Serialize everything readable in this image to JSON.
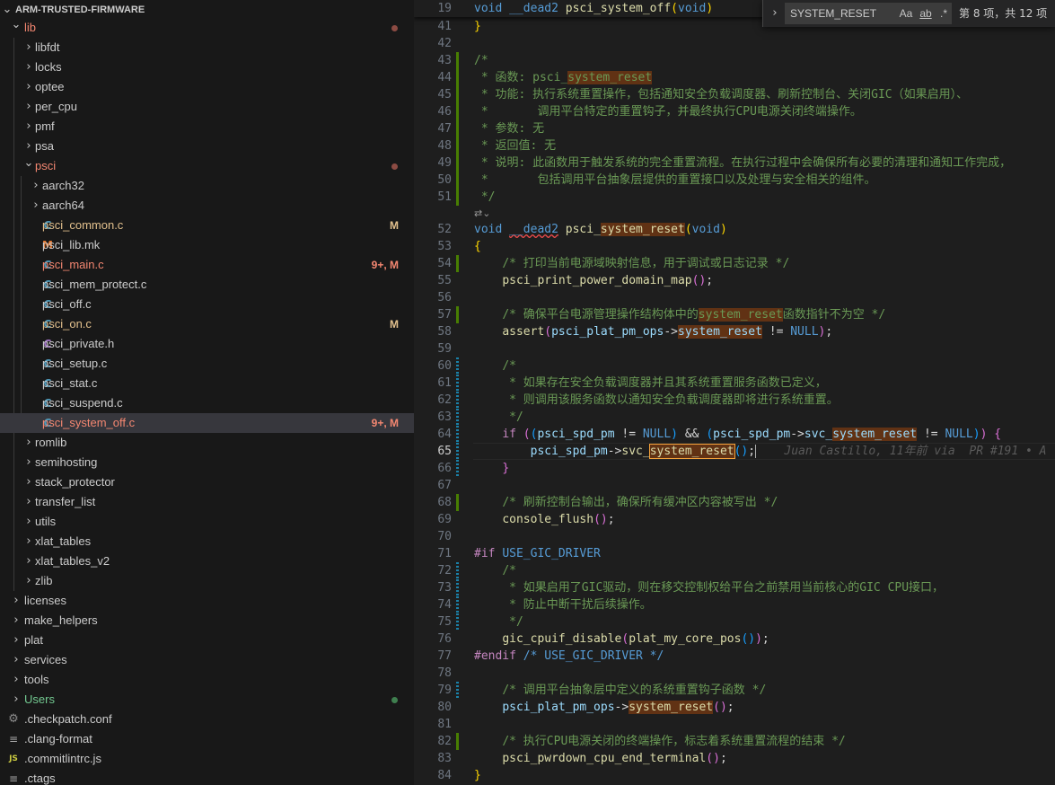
{
  "explorer": {
    "root_label": "ARM-TRUSTED-FIRMWARE",
    "items": [
      {
        "label": "lib",
        "kind": "folder-open",
        "depth": 0,
        "color": "#f48771",
        "status": "dot",
        "status_color": "#8c4b43"
      },
      {
        "label": "libfdt",
        "kind": "folder",
        "depth": 1,
        "color": "#cccccc"
      },
      {
        "label": "locks",
        "kind": "folder",
        "depth": 1,
        "color": "#cccccc"
      },
      {
        "label": "optee",
        "kind": "folder",
        "depth": 1,
        "color": "#cccccc"
      },
      {
        "label": "per_cpu",
        "kind": "folder",
        "depth": 1,
        "color": "#cccccc"
      },
      {
        "label": "pmf",
        "kind": "folder",
        "depth": 1,
        "color": "#cccccc"
      },
      {
        "label": "psa",
        "kind": "folder",
        "depth": 1,
        "color": "#cccccc"
      },
      {
        "label": "psci",
        "kind": "folder-open",
        "depth": 1,
        "color": "#f48771",
        "status": "dot",
        "status_color": "#8c4b43"
      },
      {
        "label": "aarch32",
        "kind": "folder",
        "depth": 2,
        "color": "#cccccc"
      },
      {
        "label": "aarch64",
        "kind": "folder",
        "depth": 2,
        "color": "#cccccc"
      },
      {
        "label": "psci_common.c",
        "kind": "c",
        "depth": 2,
        "color": "#e2c08d",
        "status": "M",
        "status_color": "#e2c08d"
      },
      {
        "label": "psci_lib.mk",
        "kind": "mk",
        "depth": 2,
        "color": "#cccccc"
      },
      {
        "label": "psci_main.c",
        "kind": "c",
        "depth": 2,
        "color": "#f48771",
        "status": "9+, M",
        "status_color": "#f48771"
      },
      {
        "label": "psci_mem_protect.c",
        "kind": "c",
        "depth": 2,
        "color": "#cccccc"
      },
      {
        "label": "psci_off.c",
        "kind": "c",
        "depth": 2,
        "color": "#cccccc"
      },
      {
        "label": "psci_on.c",
        "kind": "c",
        "depth": 2,
        "color": "#e2c08d",
        "status": "M",
        "status_color": "#e2c08d"
      },
      {
        "label": "psci_private.h",
        "kind": "h",
        "depth": 2,
        "color": "#cccccc"
      },
      {
        "label": "psci_setup.c",
        "kind": "c",
        "depth": 2,
        "color": "#cccccc"
      },
      {
        "label": "psci_stat.c",
        "kind": "c",
        "depth": 2,
        "color": "#cccccc"
      },
      {
        "label": "psci_suspend.c",
        "kind": "c",
        "depth": 2,
        "color": "#cccccc"
      },
      {
        "label": "psci_system_off.c",
        "kind": "c",
        "depth": 2,
        "color": "#f48771",
        "status": "9+, M",
        "status_color": "#f48771",
        "selected": true
      },
      {
        "label": "romlib",
        "kind": "folder",
        "depth": 1,
        "color": "#cccccc"
      },
      {
        "label": "semihosting",
        "kind": "folder",
        "depth": 1,
        "color": "#cccccc"
      },
      {
        "label": "stack_protector",
        "kind": "folder",
        "depth": 1,
        "color": "#cccccc"
      },
      {
        "label": "transfer_list",
        "kind": "folder",
        "depth": 1,
        "color": "#cccccc"
      },
      {
        "label": "utils",
        "kind": "folder",
        "depth": 1,
        "color": "#cccccc"
      },
      {
        "label": "xlat_tables",
        "kind": "folder",
        "depth": 1,
        "color": "#cccccc"
      },
      {
        "label": "xlat_tables_v2",
        "kind": "folder",
        "depth": 1,
        "color": "#cccccc"
      },
      {
        "label": "zlib",
        "kind": "folder",
        "depth": 1,
        "color": "#cccccc"
      },
      {
        "label": "licenses",
        "kind": "folder",
        "depth": 0,
        "color": "#cccccc"
      },
      {
        "label": "make_helpers",
        "kind": "folder",
        "depth": 0,
        "color": "#cccccc"
      },
      {
        "label": "plat",
        "kind": "folder",
        "depth": 0,
        "color": "#cccccc"
      },
      {
        "label": "services",
        "kind": "folder",
        "depth": 0,
        "color": "#cccccc"
      },
      {
        "label": "tools",
        "kind": "folder",
        "depth": 0,
        "color": "#cccccc"
      },
      {
        "label": "Users",
        "kind": "folder",
        "depth": 0,
        "color": "#73c991",
        "status": "dot",
        "status_color": "#3f7f4f"
      },
      {
        "label": ".checkpatch.conf",
        "kind": "gear",
        "depth": -1,
        "color": "#cccccc"
      },
      {
        "label": ".clang-format",
        "kind": "lines",
        "depth": -1,
        "color": "#cccccc"
      },
      {
        "label": ".commitlintrc.js",
        "kind": "js",
        "depth": -1,
        "color": "#cccccc"
      },
      {
        "label": ".ctags",
        "kind": "lines",
        "depth": -1,
        "color": "#cccccc"
      }
    ]
  },
  "find": {
    "query": "SYSTEM_RESET",
    "match_case": "Aa",
    "whole_word": "ab",
    "regex": ".*",
    "count": "第 8 项，共 12 项"
  },
  "editor": {
    "sticky_line": {
      "number": "19",
      "tokens": [
        {
          "t": "void",
          "c": "kw"
        },
        {
          "t": " "
        },
        {
          "t": "__dead2",
          "c": "kw"
        },
        {
          "t": " "
        },
        {
          "t": "psci_system_off",
          "c": "fn"
        },
        {
          "t": "(",
          "c": "br1"
        },
        {
          "t": "void",
          "c": "kw"
        },
        {
          "t": ")",
          "c": "br1"
        }
      ]
    },
    "codelens_icon": "git-compare-icon",
    "lines": [
      {
        "n": "41",
        "tokens": [
          {
            "t": "}",
            "c": "br1"
          }
        ]
      },
      {
        "n": "42",
        "tokens": []
      },
      {
        "n": "43",
        "gutter": "green",
        "tokens": [
          {
            "t": "/*",
            "c": "cm"
          }
        ]
      },
      {
        "n": "44",
        "gutter": "green",
        "tokens": [
          {
            "t": " * 函数: psci_",
            "c": "cm"
          },
          {
            "t": "system_reset",
            "c": "cm hl"
          }
        ]
      },
      {
        "n": "45",
        "gutter": "green",
        "tokens": [
          {
            "t": " * 功能: 执行系统重置操作，包括通知安全负载调度器、刷新控制台、关闭GIC（如果启用）、",
            "c": "cm"
          }
        ]
      },
      {
        "n": "46",
        "gutter": "green",
        "tokens": [
          {
            "t": " *       调用平台特定的重置钩子，并最终执行CPU电源关闭终端操作。",
            "c": "cm"
          }
        ]
      },
      {
        "n": "47",
        "gutter": "green",
        "tokens": [
          {
            "t": " * 参数: 无",
            "c": "cm"
          }
        ]
      },
      {
        "n": "48",
        "gutter": "green",
        "tokens": [
          {
            "t": " * 返回值: 无",
            "c": "cm"
          }
        ]
      },
      {
        "n": "49",
        "gutter": "green",
        "tokens": [
          {
            "t": " * 说明: 此函数用于触发系统的完全重置流程。在执行过程中会确保所有必要的清理和通知工作完成，",
            "c": "cm"
          }
        ]
      },
      {
        "n": "50",
        "gutter": "green",
        "tokens": [
          {
            "t": " *       包括调用平台抽象层提供的重置接口以及处理与安全相关的组件。",
            "c": "cm"
          }
        ]
      },
      {
        "n": "51",
        "gutter": "green",
        "tokens": [
          {
            "t": " */",
            "c": "cm"
          }
        ]
      },
      {
        "n": "",
        "codelens": true,
        "tokens": []
      },
      {
        "n": "52",
        "tokens": [
          {
            "t": "void",
            "c": "kw"
          },
          {
            "t": " "
          },
          {
            "t": "__dead2",
            "c": "kw sq"
          },
          {
            "t": " "
          },
          {
            "t": "psci_",
            "c": "fn"
          },
          {
            "t": "system_reset",
            "c": "fn hl"
          },
          {
            "t": "(",
            "c": "br1"
          },
          {
            "t": "void",
            "c": "kw"
          },
          {
            "t": ")",
            "c": "br1"
          }
        ]
      },
      {
        "n": "53",
        "tokens": [
          {
            "t": "{",
            "c": "br1"
          }
        ]
      },
      {
        "n": "54",
        "gutter": "green",
        "tokens": [
          {
            "t": "    "
          },
          {
            "t": "/* 打印当前电源域映射信息，用于调试或日志记录 */",
            "c": "cm"
          }
        ]
      },
      {
        "n": "55",
        "tokens": [
          {
            "t": "    "
          },
          {
            "t": "psci_print_power_domain_map",
            "c": "fn"
          },
          {
            "t": "()",
            "c": "br2"
          },
          {
            "t": ";"
          }
        ]
      },
      {
        "n": "56",
        "tokens": []
      },
      {
        "n": "57",
        "gutter": "green",
        "tokens": [
          {
            "t": "    "
          },
          {
            "t": "/* 确保平台电源管理操作结构体中的",
            "c": "cm"
          },
          {
            "t": "system_reset",
            "c": "cm hl"
          },
          {
            "t": "函数指针不为空 */",
            "c": "cm"
          }
        ]
      },
      {
        "n": "58",
        "tokens": [
          {
            "t": "    "
          },
          {
            "t": "assert",
            "c": "fn"
          },
          {
            "t": "(",
            "c": "br2"
          },
          {
            "t": "psci_plat_pm_ops",
            "c": "var"
          },
          {
            "t": "->"
          },
          {
            "t": "system_reset",
            "c": "var hl"
          },
          {
            "t": " != "
          },
          {
            "t": "NULL",
            "c": "kw"
          },
          {
            "t": ")",
            "c": "br2"
          },
          {
            "t": ";"
          }
        ]
      },
      {
        "n": "59",
        "tokens": []
      },
      {
        "n": "60",
        "gutter": "blue",
        "tokens": [
          {
            "t": "    "
          },
          {
            "t": "/*",
            "c": "cm"
          }
        ]
      },
      {
        "n": "61",
        "gutter": "blue",
        "tokens": [
          {
            "t": "    "
          },
          {
            "t": " * 如果存在安全负载调度器并且其系统重置服务函数已定义，",
            "c": "cm"
          }
        ]
      },
      {
        "n": "62",
        "gutter": "blue",
        "tokens": [
          {
            "t": "    "
          },
          {
            "t": " * 则调用该服务函数以通知安全负载调度器即将进行系统重置。",
            "c": "cm"
          }
        ]
      },
      {
        "n": "63",
        "gutter": "blue",
        "tokens": [
          {
            "t": "    "
          },
          {
            "t": " */",
            "c": "cm"
          }
        ]
      },
      {
        "n": "64",
        "gutter": "blue",
        "tokens": [
          {
            "t": "    "
          },
          {
            "t": "if",
            "c": "pp"
          },
          {
            "t": " "
          },
          {
            "t": "(",
            "c": "br2"
          },
          {
            "t": "(",
            "c": "br3"
          },
          {
            "t": "psci_spd_pm",
            "c": "var"
          },
          {
            "t": " != "
          },
          {
            "t": "NULL",
            "c": "kw"
          },
          {
            "t": ")",
            "c": "br3"
          },
          {
            "t": " && "
          },
          {
            "t": "(",
            "c": "br3"
          },
          {
            "t": "psci_spd_pm",
            "c": "var"
          },
          {
            "t": "->"
          },
          {
            "t": "svc_",
            "c": "var"
          },
          {
            "t": "system_reset",
            "c": "var hl"
          },
          {
            "t": " != "
          },
          {
            "t": "NULL",
            "c": "kw"
          },
          {
            "t": ")",
            "c": "br3"
          },
          {
            "t": ")",
            "c": "br2"
          },
          {
            "t": " "
          },
          {
            "t": "{",
            "c": "br2"
          }
        ]
      },
      {
        "n": "65",
        "current": true,
        "gutter": "blue",
        "tokens": [
          {
            "t": "        "
          },
          {
            "t": "psci_spd_pm",
            "c": "var"
          },
          {
            "t": "->"
          },
          {
            "t": "svc_",
            "c": "fn"
          },
          {
            "t": "system_reset",
            "c": "fn hlc"
          },
          {
            "t": "()",
            "c": "br3"
          },
          {
            "t": ";"
          }
        ],
        "blame": "Juan Castillo, 11年前 via  PR #191 • A"
      },
      {
        "n": "66",
        "gutter": "blue",
        "tokens": [
          {
            "t": "    "
          },
          {
            "t": "}",
            "c": "br2"
          }
        ]
      },
      {
        "n": "67",
        "tokens": []
      },
      {
        "n": "68",
        "gutter": "green",
        "tokens": [
          {
            "t": "    "
          },
          {
            "t": "/* 刷新控制台输出，确保所有缓冲区内容被写出 */",
            "c": "cm"
          }
        ]
      },
      {
        "n": "69",
        "tokens": [
          {
            "t": "    "
          },
          {
            "t": "console_flush",
            "c": "fn"
          },
          {
            "t": "()",
            "c": "br2"
          },
          {
            "t": ";"
          }
        ]
      },
      {
        "n": "70",
        "tokens": []
      },
      {
        "n": "71",
        "tokens": [
          {
            "t": "#if",
            "c": "pp"
          },
          {
            "t": " "
          },
          {
            "t": "USE_GIC_DRIVER",
            "c": "kw"
          }
        ]
      },
      {
        "n": "72",
        "gutter": "blue",
        "tokens": [
          {
            "t": "    "
          },
          {
            "t": "/*",
            "c": "cm"
          }
        ]
      },
      {
        "n": "73",
        "gutter": "blue",
        "tokens": [
          {
            "t": "    "
          },
          {
            "t": " * 如果启用了GIC驱动，则在移交控制权给平台之前禁用当前核心的GIC CPU接口，",
            "c": "cm"
          }
        ]
      },
      {
        "n": "74",
        "gutter": "blue",
        "tokens": [
          {
            "t": "    "
          },
          {
            "t": " * 防止中断干扰后续操作。",
            "c": "cm"
          }
        ]
      },
      {
        "n": "75",
        "gutter": "blue",
        "tokens": [
          {
            "t": "    "
          },
          {
            "t": " */",
            "c": "cm"
          }
        ]
      },
      {
        "n": "76",
        "tokens": [
          {
            "t": "    "
          },
          {
            "t": "gic_cpuif_disable",
            "c": "fn"
          },
          {
            "t": "(",
            "c": "br2"
          },
          {
            "t": "plat_my_core_pos",
            "c": "fn"
          },
          {
            "t": "()",
            "c": "br3"
          },
          {
            "t": ")",
            "c": "br2"
          },
          {
            "t": ";"
          }
        ]
      },
      {
        "n": "77",
        "tokens": [
          {
            "t": "#endif",
            "c": "pp"
          },
          {
            "t": " "
          },
          {
            "t": "/* USE_GIC_DRIVER */",
            "c": "kw"
          }
        ]
      },
      {
        "n": "78",
        "tokens": []
      },
      {
        "n": "79",
        "gutter": "blue",
        "tokens": [
          {
            "t": "    "
          },
          {
            "t": "/* 调用平台抽象层中定义的系统重置钩子函数 */",
            "c": "cm"
          }
        ]
      },
      {
        "n": "80",
        "tokens": [
          {
            "t": "    "
          },
          {
            "t": "psci_plat_pm_ops",
            "c": "var"
          },
          {
            "t": "->"
          },
          {
            "t": "system_reset",
            "c": "fn hl"
          },
          {
            "t": "()",
            "c": "br2"
          },
          {
            "t": ";"
          }
        ]
      },
      {
        "n": "81",
        "tokens": []
      },
      {
        "n": "82",
        "gutter": "green",
        "tokens": [
          {
            "t": "    "
          },
          {
            "t": "/* 执行CPU电源关闭的终端操作，标志着系统重置流程的结束 */",
            "c": "cm"
          }
        ]
      },
      {
        "n": "83",
        "tokens": [
          {
            "t": "    "
          },
          {
            "t": "psci_pwrdown_cpu_end_terminal",
            "c": "fn"
          },
          {
            "t": "()",
            "c": "br2"
          },
          {
            "t": ";"
          }
        ]
      },
      {
        "n": "84",
        "tokens": [
          {
            "t": "}",
            "c": "br1"
          }
        ]
      }
    ]
  }
}
